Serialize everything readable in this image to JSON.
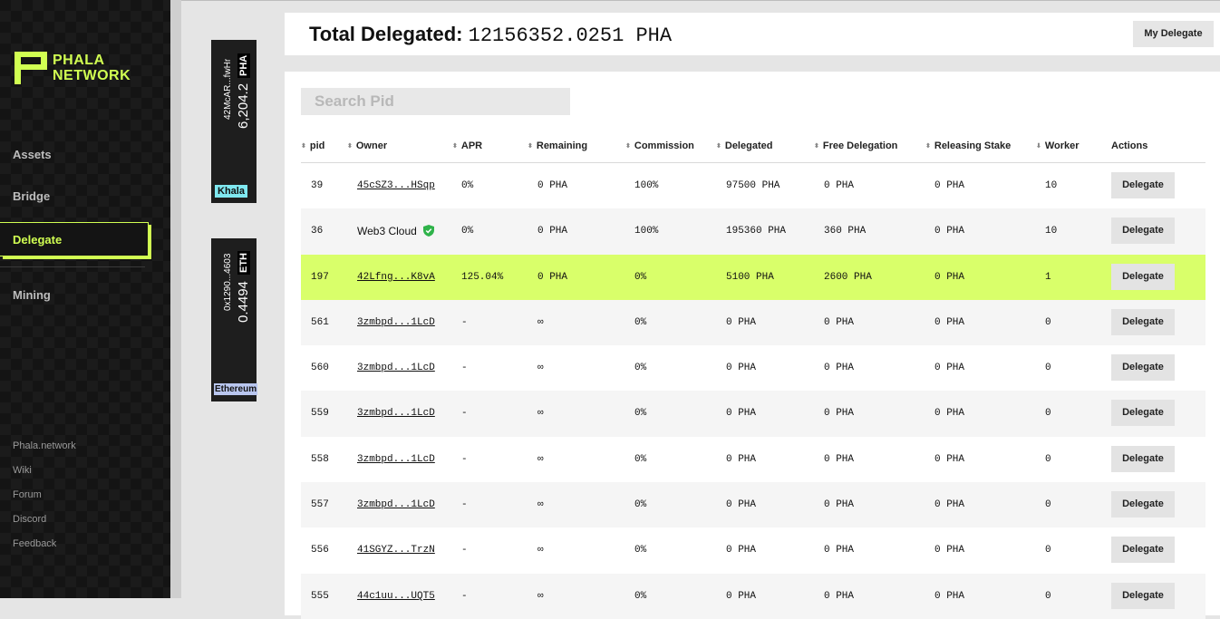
{
  "brand": {
    "line1": "PHALA",
    "line2": "NETWORK",
    "accent": "#d1ff52"
  },
  "nav": {
    "assets": "Assets",
    "bridge": "Bridge",
    "delegate": "Delegate",
    "mining": "Mining"
  },
  "footer_links": [
    "Phala.network",
    "Wiki",
    "Forum",
    "Discord",
    "Feedback"
  ],
  "wallets": [
    {
      "address": "42McAR...fwHr",
      "amount": "6,204.2",
      "symbol": "PHA",
      "network": "Khala",
      "network_color": "#7fe8f0"
    },
    {
      "address": "0x1290...4603",
      "amount": "0.4494",
      "symbol": "ETH",
      "network": "Ethereum",
      "network_color": "#b9c6ef"
    }
  ],
  "header": {
    "total_label": "Total Delegated:",
    "total_value": "12156352.0251 PHA",
    "my_delegate": "My Delegate"
  },
  "search": {
    "placeholder": "Search Pid"
  },
  "table": {
    "columns": [
      "pid",
      "Owner",
      "APR",
      "Remaining",
      "Commission",
      "Delegated",
      "Free Delegation",
      "Releasing Stake",
      "Worker",
      "Actions"
    ],
    "action_label": "Delegate",
    "rows": [
      {
        "pid": "39",
        "owner": "45cSZ3...HSqp",
        "apr": "0%",
        "remaining": "0 PHA",
        "commission": "100%",
        "delegated": "97500 PHA",
        "free": "0 PHA",
        "releasing": "0 PHA",
        "worker": "10"
      },
      {
        "pid": "36",
        "owner": "Web3 Cloud",
        "apr": "0%",
        "remaining": "0 PHA",
        "commission": "100%",
        "delegated": "195360 PHA",
        "free": "360 PHA",
        "releasing": "0 PHA",
        "worker": "10"
      },
      {
        "pid": "197",
        "owner": "42Lfng...K8vA",
        "apr": "125.04%",
        "remaining": "0 PHA",
        "commission": "0%",
        "delegated": "5100 PHA",
        "free": "2600 PHA",
        "releasing": "0 PHA",
        "worker": "1"
      },
      {
        "pid": "561",
        "owner": "3zmbpd...1LcD",
        "apr": "-",
        "remaining": "∞",
        "commission": "0%",
        "delegated": "0 PHA",
        "free": "0 PHA",
        "releasing": "0 PHA",
        "worker": "0"
      },
      {
        "pid": "560",
        "owner": "3zmbpd...1LcD",
        "apr": "-",
        "remaining": "∞",
        "commission": "0%",
        "delegated": "0 PHA",
        "free": "0 PHA",
        "releasing": "0 PHA",
        "worker": "0"
      },
      {
        "pid": "559",
        "owner": "3zmbpd...1LcD",
        "apr": "-",
        "remaining": "∞",
        "commission": "0%",
        "delegated": "0 PHA",
        "free": "0 PHA",
        "releasing": "0 PHA",
        "worker": "0"
      },
      {
        "pid": "558",
        "owner": "3zmbpd...1LcD",
        "apr": "-",
        "remaining": "∞",
        "commission": "0%",
        "delegated": "0 PHA",
        "free": "0 PHA",
        "releasing": "0 PHA",
        "worker": "0"
      },
      {
        "pid": "557",
        "owner": "3zmbpd...1LcD",
        "apr": "-",
        "remaining": "∞",
        "commission": "0%",
        "delegated": "0 PHA",
        "free": "0 PHA",
        "releasing": "0 PHA",
        "worker": "0"
      },
      {
        "pid": "556",
        "owner": "41SGYZ...TrzN",
        "apr": "-",
        "remaining": "∞",
        "commission": "0%",
        "delegated": "0 PHA",
        "free": "0 PHA",
        "releasing": "0 PHA",
        "worker": "0"
      },
      {
        "pid": "555",
        "owner": "44c1uu...UQT5",
        "apr": "-",
        "remaining": "∞",
        "commission": "0%",
        "delegated": "0 PHA",
        "free": "0 PHA",
        "releasing": "0 PHA",
        "worker": "0"
      }
    ]
  },
  "colors": {
    "sidebar_bg": "#141414",
    "highlight_row": "#d9ff6a",
    "verified_shield": "#2fb34a"
  }
}
